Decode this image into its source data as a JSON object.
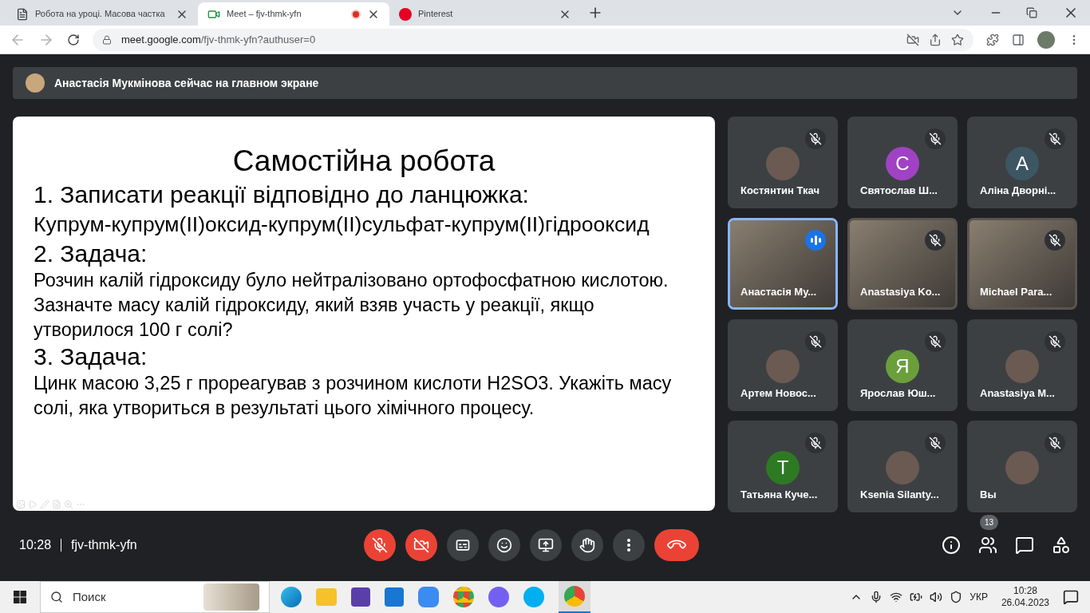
{
  "browser": {
    "tabs": [
      {
        "title": "Робота на уроці. Масова частка",
        "selected": false,
        "recording": false,
        "kind": "doc"
      },
      {
        "title": "Meet – fjv-thmk-yfn",
        "selected": true,
        "recording": true,
        "kind": "meet"
      },
      {
        "title": "Pinterest",
        "selected": false,
        "recording": false,
        "kind": "pinterest"
      }
    ],
    "url_host": "meet.google.com",
    "url_path": "/fjv-thmk-yfn?authuser=0"
  },
  "banner": {
    "text": "Анастасія Мукмінова сейчас на главном экране"
  },
  "slide": {
    "title": "Самостійна робота",
    "lines": [
      {
        "kind": "heading",
        "text": "1. Записати реакції відповідно до ланцюжка:"
      },
      {
        "kind": "formula",
        "text": "Купрум-купрум(II)оксид-купрум(II)сульфат-купрум(II)гідрооксид"
      },
      {
        "kind": "heading",
        "text": "2. Задача:"
      },
      {
        "kind": "body",
        "text": "Розчин калій гідроксиду було нейтралізовано ортофосфатною кислотою. Зазначте масу калій гідроксиду, який взяв участь у реакції, якщо утворилося 100 г солі?"
      },
      {
        "kind": "heading",
        "text": "3.  Задача:"
      },
      {
        "kind": "body",
        "text": "Цинк масою 3,25 г прореагував з розчином кислоти H2SO3. Укажіть масу солі, яка утвориться в результаті цього хімічного процесу."
      }
    ]
  },
  "participants": [
    {
      "name": "Костянтин Ткач",
      "kind": "photo-avatar",
      "muted": true,
      "speaking": false
    },
    {
      "name": "Святослав Ш...",
      "kind": "letter",
      "letter": "C",
      "color": "#a142c4",
      "muted": true,
      "speaking": false
    },
    {
      "name": "Аліна Дворні...",
      "kind": "letter",
      "letter": "A",
      "color": "#3c5664",
      "muted": true,
      "speaking": false
    },
    {
      "name": "Анастасія Му...",
      "kind": "video",
      "muted": false,
      "speaking": true
    },
    {
      "name": "Anastasiya Ko...",
      "kind": "video",
      "muted": true,
      "speaking": false
    },
    {
      "name": "Michael Para...",
      "kind": "video",
      "muted": true,
      "speaking": false
    },
    {
      "name": "Артем Новос...",
      "kind": "photo-avatar",
      "muted": true,
      "speaking": false
    },
    {
      "name": "Ярослав Юш...",
      "kind": "letter",
      "letter": "Я",
      "color": "#6a9f3c",
      "muted": true,
      "speaking": false
    },
    {
      "name": "Anastasiya M...",
      "kind": "photo-avatar",
      "muted": true,
      "speaking": false
    },
    {
      "name": "Татьяна Куче...",
      "kind": "letter",
      "letter": "T",
      "color": "#2d7a23",
      "muted": true,
      "speaking": false
    },
    {
      "name": "Ksenia Silanty...",
      "kind": "photo-avatar",
      "muted": true,
      "speaking": false
    },
    {
      "name": "Вы",
      "kind": "photo-avatar",
      "muted": true,
      "speaking": false
    }
  ],
  "call_bar": {
    "time": "10:28",
    "code": "fjv-thmk-yfn",
    "microphone_on": false,
    "camera_on": false,
    "people_count": "13"
  },
  "taskbar": {
    "search_placeholder": "Поиск",
    "language": "УКР",
    "time": "10:28",
    "date": "26.04.2023"
  }
}
